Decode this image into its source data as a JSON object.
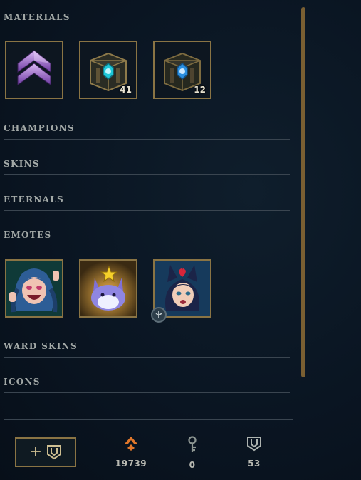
{
  "sections": {
    "materials": "MATERIALS",
    "champions": "CHAMPIONS",
    "skins": "SKINS",
    "eternals": "ETERNALS",
    "emotes": "EMOTES",
    "ward_skins": "WARD SKINS",
    "icons": "ICONS"
  },
  "materials": [
    {
      "icon": "mastery-token-chevron-icon",
      "count": ""
    },
    {
      "icon": "hextech-chest-icon",
      "count": "41"
    },
    {
      "icon": "hextech-chest-icon",
      "count": "12"
    }
  ],
  "emotes": [
    {
      "icon": "jinx-emote-icon"
    },
    {
      "icon": "poro-star-emote-icon"
    },
    {
      "icon": "vex-heart-emote-icon",
      "badge": "emote-badge-icon"
    }
  ],
  "footer": {
    "add_button_plus": "+",
    "currencies": [
      {
        "icon": "orange-essence-icon",
        "value": "19739",
        "color": "#e0772b"
      },
      {
        "icon": "key-fragment-icon",
        "value": "0",
        "color": "#8c9591"
      },
      {
        "icon": "chest-shield-icon",
        "value": "53",
        "color": "#aeb4b0"
      }
    ]
  },
  "colors": {
    "gold_border": "#8a7444",
    "scrollbar": "#7a5f32",
    "essence": "#e0772b"
  }
}
